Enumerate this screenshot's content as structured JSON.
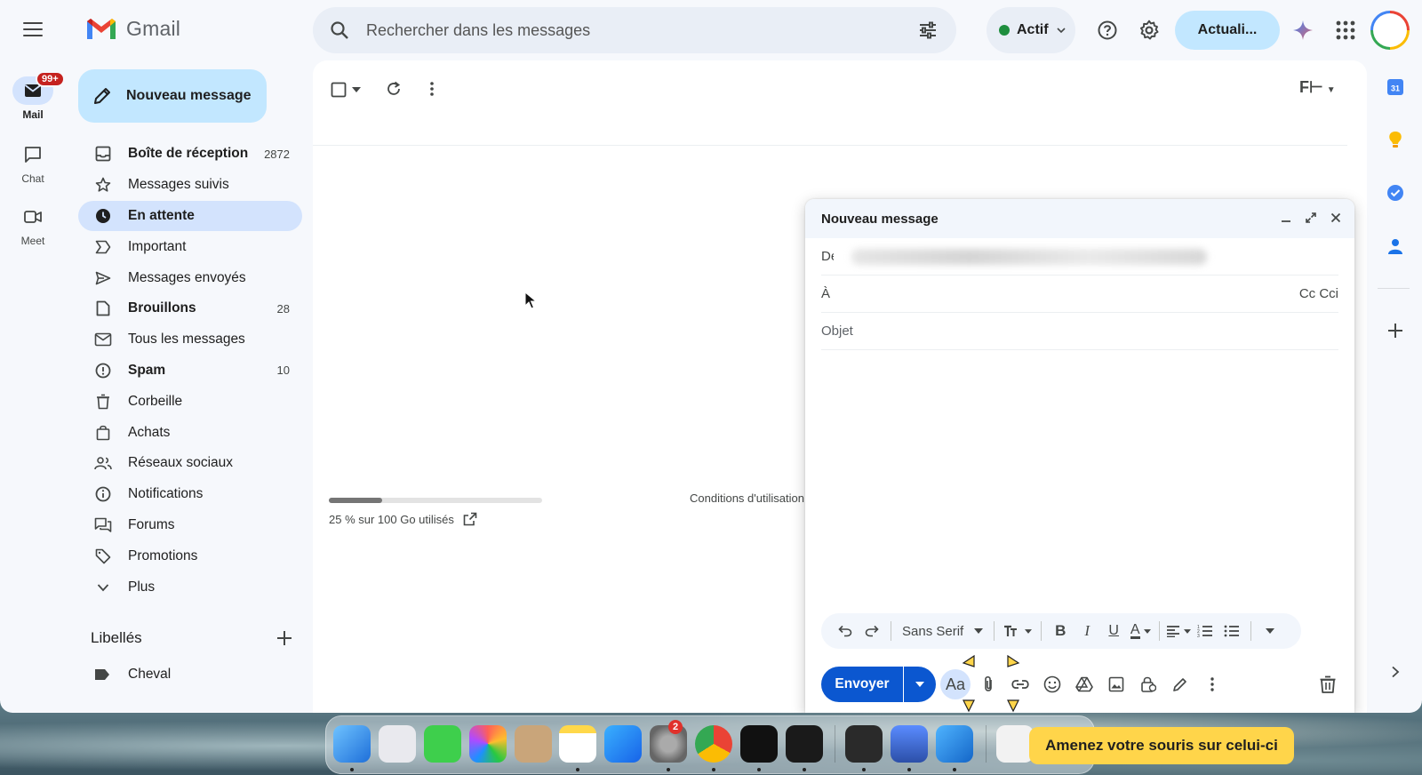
{
  "header": {
    "app_name": "Gmail",
    "search_placeholder": "Rechercher dans les messages",
    "status_label": "Actif",
    "update_button": "Actuali..."
  },
  "rail": {
    "items": [
      {
        "label": "Mail",
        "badge": "99+"
      },
      {
        "label": "Chat"
      },
      {
        "label": "Meet"
      }
    ]
  },
  "compose_button": "Nouveau message",
  "nav": {
    "items": [
      {
        "label": "Boîte de réception",
        "count": "2872",
        "icon": "inbox-icon"
      },
      {
        "label": "Messages suivis",
        "count": "",
        "icon": "star-icon"
      },
      {
        "label": "En attente",
        "count": "",
        "icon": "clock-icon"
      },
      {
        "label": "Important",
        "count": "",
        "icon": "important-icon"
      },
      {
        "label": "Messages envoyés",
        "count": "",
        "icon": "send-icon"
      },
      {
        "label": "Brouillons",
        "count": "28",
        "icon": "draft-icon"
      },
      {
        "label": "Tous les messages",
        "count": "",
        "icon": "all-mail-icon"
      },
      {
        "label": "Spam",
        "count": "10",
        "icon": "spam-icon"
      },
      {
        "label": "Corbeille",
        "count": "",
        "icon": "trash-icon"
      },
      {
        "label": "Achats",
        "count": "",
        "icon": "shopping-icon"
      },
      {
        "label": "Réseaux sociaux",
        "count": "",
        "icon": "social-icon"
      },
      {
        "label": "Notifications",
        "count": "",
        "icon": "info-icon"
      },
      {
        "label": "Forums",
        "count": "",
        "icon": "forum-icon"
      },
      {
        "label": "Promotions",
        "count": "",
        "icon": "tag-icon"
      },
      {
        "label": "Plus",
        "count": "",
        "icon": "chevron-down-icon"
      }
    ]
  },
  "labels": {
    "title": "Libellés",
    "items": [
      {
        "label": "Cheval"
      }
    ]
  },
  "main": {
    "storage_text": "25 % sur 100 Go utilisés",
    "storage_percent": 25,
    "terms_text": "Conditions d'utilisation"
  },
  "compose": {
    "title": "Nouveau message",
    "from_label": "De",
    "to_label": "À",
    "cc_label": "Cc Cci",
    "subject_placeholder": "Objet",
    "font_name": "Sans Serif",
    "send_label": "Envoyer",
    "aa_label": "Aa"
  },
  "dock": {
    "settings_badge": "2",
    "tooltip": "Amenez votre souris sur celui-ci"
  },
  "colors": {
    "accent": "#0b57d0",
    "compose_bg": "#c2e7ff",
    "active_nav": "#d3e3fd",
    "tooltip": "#ffd54a"
  }
}
